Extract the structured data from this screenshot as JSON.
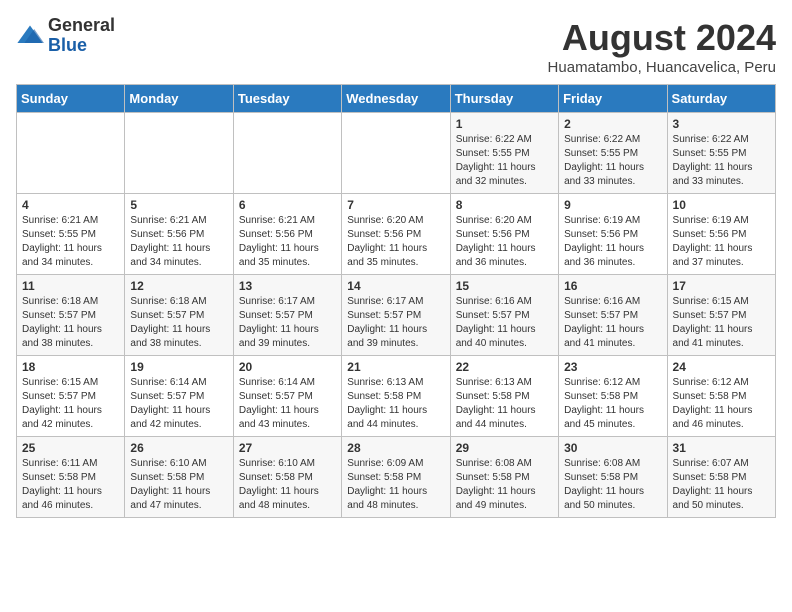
{
  "header": {
    "logo_general": "General",
    "logo_blue": "Blue",
    "title": "August 2024",
    "subtitle": "Huamatambo, Huancavelica, Peru"
  },
  "calendar": {
    "days_of_week": [
      "Sunday",
      "Monday",
      "Tuesday",
      "Wednesday",
      "Thursday",
      "Friday",
      "Saturday"
    ],
    "weeks": [
      [
        {
          "day": "",
          "info": ""
        },
        {
          "day": "",
          "info": ""
        },
        {
          "day": "",
          "info": ""
        },
        {
          "day": "",
          "info": ""
        },
        {
          "day": "1",
          "info": "Sunrise: 6:22 AM\nSunset: 5:55 PM\nDaylight: 11 hours\nand 32 minutes."
        },
        {
          "day": "2",
          "info": "Sunrise: 6:22 AM\nSunset: 5:55 PM\nDaylight: 11 hours\nand 33 minutes."
        },
        {
          "day": "3",
          "info": "Sunrise: 6:22 AM\nSunset: 5:55 PM\nDaylight: 11 hours\nand 33 minutes."
        }
      ],
      [
        {
          "day": "4",
          "info": "Sunrise: 6:21 AM\nSunset: 5:55 PM\nDaylight: 11 hours\nand 34 minutes."
        },
        {
          "day": "5",
          "info": "Sunrise: 6:21 AM\nSunset: 5:56 PM\nDaylight: 11 hours\nand 34 minutes."
        },
        {
          "day": "6",
          "info": "Sunrise: 6:21 AM\nSunset: 5:56 PM\nDaylight: 11 hours\nand 35 minutes."
        },
        {
          "day": "7",
          "info": "Sunrise: 6:20 AM\nSunset: 5:56 PM\nDaylight: 11 hours\nand 35 minutes."
        },
        {
          "day": "8",
          "info": "Sunrise: 6:20 AM\nSunset: 5:56 PM\nDaylight: 11 hours\nand 36 minutes."
        },
        {
          "day": "9",
          "info": "Sunrise: 6:19 AM\nSunset: 5:56 PM\nDaylight: 11 hours\nand 36 minutes."
        },
        {
          "day": "10",
          "info": "Sunrise: 6:19 AM\nSunset: 5:56 PM\nDaylight: 11 hours\nand 37 minutes."
        }
      ],
      [
        {
          "day": "11",
          "info": "Sunrise: 6:18 AM\nSunset: 5:57 PM\nDaylight: 11 hours\nand 38 minutes."
        },
        {
          "day": "12",
          "info": "Sunrise: 6:18 AM\nSunset: 5:57 PM\nDaylight: 11 hours\nand 38 minutes."
        },
        {
          "day": "13",
          "info": "Sunrise: 6:17 AM\nSunset: 5:57 PM\nDaylight: 11 hours\nand 39 minutes."
        },
        {
          "day": "14",
          "info": "Sunrise: 6:17 AM\nSunset: 5:57 PM\nDaylight: 11 hours\nand 39 minutes."
        },
        {
          "day": "15",
          "info": "Sunrise: 6:16 AM\nSunset: 5:57 PM\nDaylight: 11 hours\nand 40 minutes."
        },
        {
          "day": "16",
          "info": "Sunrise: 6:16 AM\nSunset: 5:57 PM\nDaylight: 11 hours\nand 41 minutes."
        },
        {
          "day": "17",
          "info": "Sunrise: 6:15 AM\nSunset: 5:57 PM\nDaylight: 11 hours\nand 41 minutes."
        }
      ],
      [
        {
          "day": "18",
          "info": "Sunrise: 6:15 AM\nSunset: 5:57 PM\nDaylight: 11 hours\nand 42 minutes."
        },
        {
          "day": "19",
          "info": "Sunrise: 6:14 AM\nSunset: 5:57 PM\nDaylight: 11 hours\nand 42 minutes."
        },
        {
          "day": "20",
          "info": "Sunrise: 6:14 AM\nSunset: 5:57 PM\nDaylight: 11 hours\nand 43 minutes."
        },
        {
          "day": "21",
          "info": "Sunrise: 6:13 AM\nSunset: 5:58 PM\nDaylight: 11 hours\nand 44 minutes."
        },
        {
          "day": "22",
          "info": "Sunrise: 6:13 AM\nSunset: 5:58 PM\nDaylight: 11 hours\nand 44 minutes."
        },
        {
          "day": "23",
          "info": "Sunrise: 6:12 AM\nSunset: 5:58 PM\nDaylight: 11 hours\nand 45 minutes."
        },
        {
          "day": "24",
          "info": "Sunrise: 6:12 AM\nSunset: 5:58 PM\nDaylight: 11 hours\nand 46 minutes."
        }
      ],
      [
        {
          "day": "25",
          "info": "Sunrise: 6:11 AM\nSunset: 5:58 PM\nDaylight: 11 hours\nand 46 minutes."
        },
        {
          "day": "26",
          "info": "Sunrise: 6:10 AM\nSunset: 5:58 PM\nDaylight: 11 hours\nand 47 minutes."
        },
        {
          "day": "27",
          "info": "Sunrise: 6:10 AM\nSunset: 5:58 PM\nDaylight: 11 hours\nand 48 minutes."
        },
        {
          "day": "28",
          "info": "Sunrise: 6:09 AM\nSunset: 5:58 PM\nDaylight: 11 hours\nand 48 minutes."
        },
        {
          "day": "29",
          "info": "Sunrise: 6:08 AM\nSunset: 5:58 PM\nDaylight: 11 hours\nand 49 minutes."
        },
        {
          "day": "30",
          "info": "Sunrise: 6:08 AM\nSunset: 5:58 PM\nDaylight: 11 hours\nand 50 minutes."
        },
        {
          "day": "31",
          "info": "Sunrise: 6:07 AM\nSunset: 5:58 PM\nDaylight: 11 hours\nand 50 minutes."
        }
      ]
    ]
  }
}
